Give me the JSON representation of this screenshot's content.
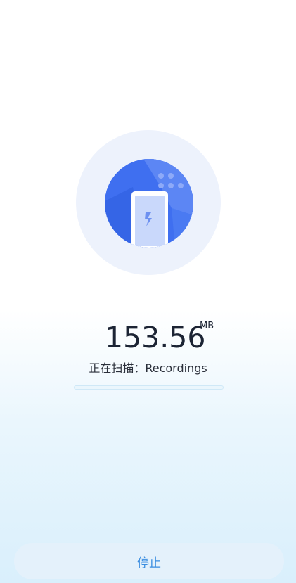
{
  "scan": {
    "size_value": "153.56",
    "size_unit": "MB",
    "status_prefix": "正在扫描：",
    "current_item": "Recordings",
    "progress_fraction": 0.0
  },
  "actions": {
    "stop_label": "停止"
  },
  "icons": {
    "illustration": "phone-scanning-icon"
  },
  "colors": {
    "accent": "#3a8de0",
    "illustration_blue": "#3f6ff0",
    "background_bottom": "#d9effc"
  }
}
